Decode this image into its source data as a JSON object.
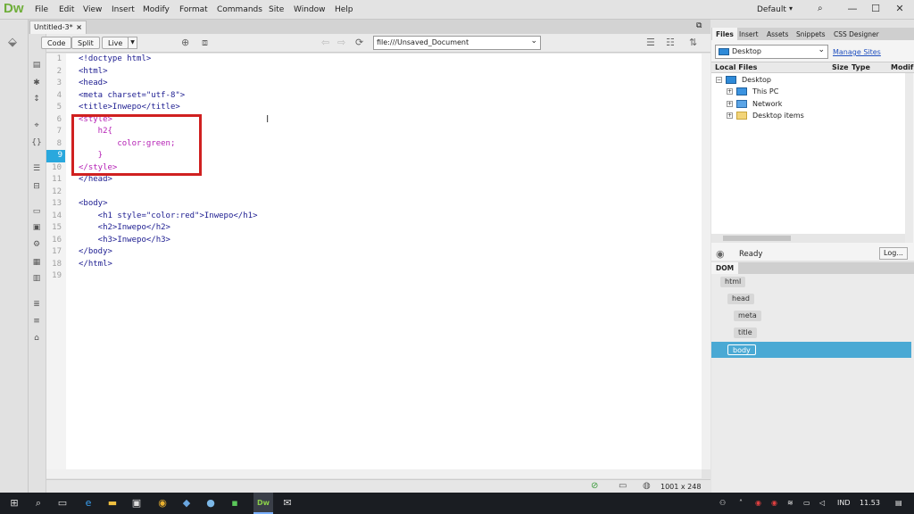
{
  "app": {
    "logo": "Dw"
  },
  "menu": [
    "File",
    "Edit",
    "View",
    "Insert",
    "Modify",
    "Format",
    "Commands",
    "Site",
    "Window",
    "Help"
  ],
  "layout_label": "Default",
  "window_controls": {
    "minimize": "—",
    "maximize": "☐",
    "close": "✕"
  },
  "document_tab": {
    "title": "Untitled-3*",
    "close": "×"
  },
  "toolbar": {
    "code": "Code",
    "split": "Split",
    "live": "Live",
    "url": "file:///Unsaved_Document"
  },
  "editor": {
    "current_line": 9,
    "lines": [
      {
        "n": "1",
        "t": "<!doctype html>",
        "pk": false
      },
      {
        "n": "2",
        "t": "<html>",
        "pk": false
      },
      {
        "n": "3",
        "t": "<head>",
        "pk": false
      },
      {
        "n": "4",
        "t": "<meta charset=\"utf-8\">",
        "pk": false
      },
      {
        "n": "5",
        "t": "<title>Inwepo</title>",
        "pk": false
      },
      {
        "n": "6",
        "t": "<style>",
        "pk": true
      },
      {
        "n": "7",
        "t": "    h2{",
        "pk": true
      },
      {
        "n": "8",
        "t": "        color:green;",
        "pk": true
      },
      {
        "n": "9",
        "t": "    }",
        "pk": true
      },
      {
        "n": "10",
        "t": "</style>",
        "pk": true
      },
      {
        "n": "11",
        "t": "</head>",
        "pk": false
      },
      {
        "n": "12",
        "t": "",
        "pk": false
      },
      {
        "n": "13",
        "t": "<body>",
        "pk": false
      },
      {
        "n": "14",
        "t": "    <h1 style=\"color:red\">Inwepo</h1>",
        "pk": false
      },
      {
        "n": "15",
        "t": "    <h2>Inwepo</h2>",
        "pk": false
      },
      {
        "n": "16",
        "t": "    <h3>Inwepo</h3>",
        "pk": false
      },
      {
        "n": "17",
        "t": "</body>",
        "pk": false
      },
      {
        "n": "18",
        "t": "</html>",
        "pk": false
      },
      {
        "n": "19",
        "t": "",
        "pk": false
      }
    ]
  },
  "status": {
    "dimensions": "1001 x 248"
  },
  "panel_tabs": [
    "Files",
    "Insert",
    "Assets",
    "Snippets",
    "CSS Designer"
  ],
  "files": {
    "site": "Desktop",
    "manage": "Manage Sites",
    "headers": {
      "name": "Local Files",
      "size": "Size",
      "type": "Type",
      "modified": "Modif"
    },
    "tree": [
      {
        "label": "Desktop",
        "icon": "desktop-icon"
      },
      {
        "label": "This PC",
        "icon": "computer-icon"
      },
      {
        "label": "Network",
        "icon": "network-icon"
      },
      {
        "label": "Desktop items",
        "icon": "folder-icon"
      }
    ],
    "status": "Ready",
    "log": "Log..."
  },
  "dom": {
    "tab": "DOM",
    "nodes": [
      "html",
      "head",
      "meta",
      "title",
      "body"
    ]
  },
  "tray": {
    "lang": "IND",
    "time": "11.53"
  },
  "colors": {
    "accent": "#29a8dd",
    "highlight": "#d02020",
    "dw_green": "#6fae3a",
    "dom_selected": "#4aa9d4"
  }
}
